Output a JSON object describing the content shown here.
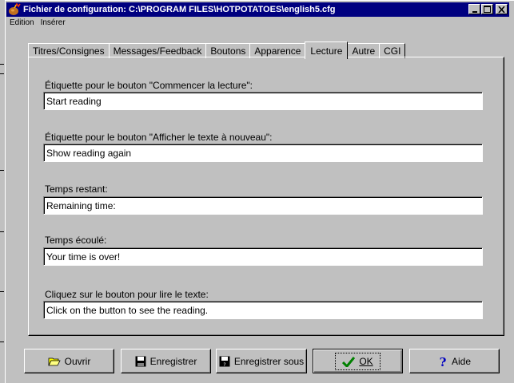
{
  "window": {
    "title": "Fichier de configuration: C:\\PROGRAM FILES\\HOTPOTATOES\\english5.cfg",
    "controls": [
      "minimize-icon",
      "maximize-icon",
      "close-icon"
    ]
  },
  "menu": [
    "Edition",
    "Insérer"
  ],
  "tabs": [
    {
      "label": "Titres/Consignes",
      "active": false
    },
    {
      "label": "Messages/Feedback",
      "active": false
    },
    {
      "label": "Boutons",
      "active": false
    },
    {
      "label": "Apparence",
      "active": false
    },
    {
      "label": "Lecture",
      "active": true
    },
    {
      "label": "Autre",
      "active": false
    },
    {
      "label": "CGI",
      "active": false
    }
  ],
  "fields": [
    {
      "label": "Étiquette pour le bouton \"Commencer la lecture\":",
      "value": "Start reading"
    },
    {
      "label": "Étiquette pour le bouton \"Afficher le texte à nouveau\":",
      "value": "Show reading again"
    },
    {
      "label": "Temps restant:",
      "value": "Remaining time:"
    },
    {
      "label": "Temps écoulé:",
      "value": "Your time is over!"
    },
    {
      "label": "Cliquez sur le bouton pour lire le texte:",
      "value": "Click on the button to see the reading."
    }
  ],
  "buttons": [
    {
      "label": "Ouvrir",
      "icon": "folder-open-icon"
    },
    {
      "label": "Enregistrer",
      "icon": "floppy-disk-icon"
    },
    {
      "label": "Enregistrer sous",
      "icon": "save-as-icon"
    },
    {
      "label": "OK",
      "icon": "checkmark-icon",
      "default": true
    },
    {
      "label": "Aide",
      "icon": "help-icon"
    }
  ]
}
